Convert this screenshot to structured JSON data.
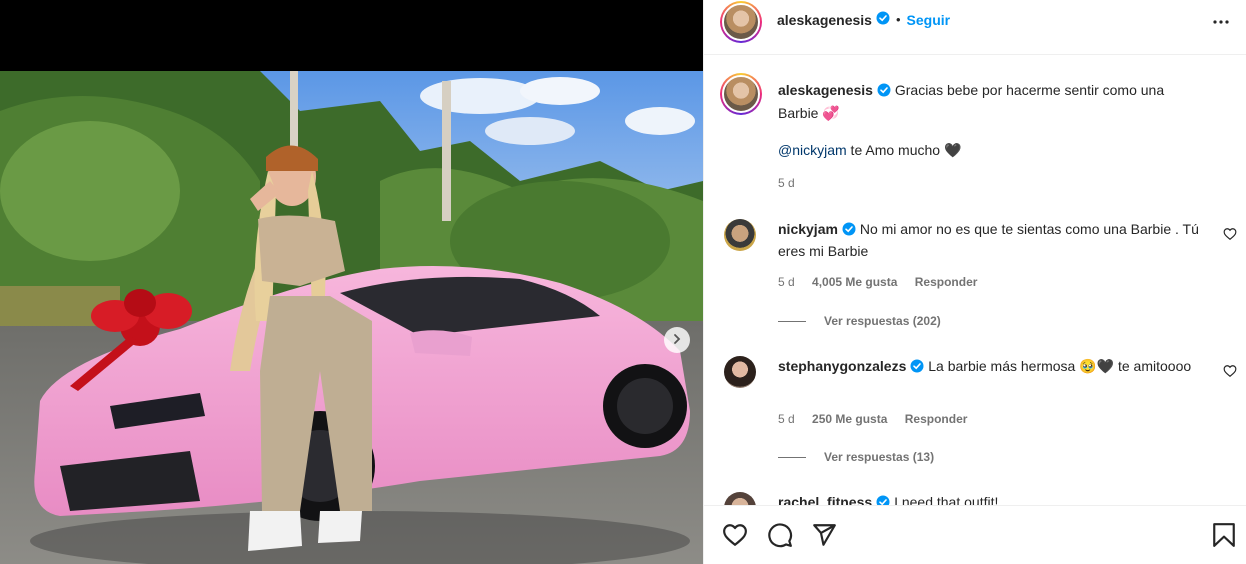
{
  "post": {
    "author": "aleskagenesis",
    "follow_label": "Seguir",
    "separator": "•",
    "caption": "Gracias bebe por hacerme sentir como una Barbie 💞",
    "caption_line2_mention": "@nickyjam",
    "caption_line2_text": " te Amo mucho 🖤",
    "caption_age": "5 d"
  },
  "comments": [
    {
      "username": "nickyjam",
      "text": "No mi amor no es que te sientas como una Barbie . Tú eres mi Barbie",
      "age": "5 d",
      "likes": "4,005 Me gusta",
      "reply_label": "Responder",
      "view_replies": "Ver respuestas (202)"
    },
    {
      "username": "stephanygonzalezs",
      "text": "La barbie más hermosa 🥹🖤 te amitoooo",
      "age": "5 d",
      "likes": "250 Me gusta",
      "reply_label": "Responder",
      "view_replies": "Ver respuestas (13)"
    },
    {
      "username": "rachel_fitness",
      "text": "I need that outfit!"
    }
  ],
  "icons": {
    "verified": "verified-badge-icon",
    "more": "more-options-icon",
    "like": "heart-icon",
    "comment": "comment-icon",
    "share": "share-icon",
    "save": "bookmark-icon",
    "next": "chevron-right-icon"
  },
  "colors": {
    "accent": "#0095f6",
    "verified": "#0095f6",
    "mention": "#00376b",
    "muted": "#737373",
    "border": "#efefef"
  }
}
